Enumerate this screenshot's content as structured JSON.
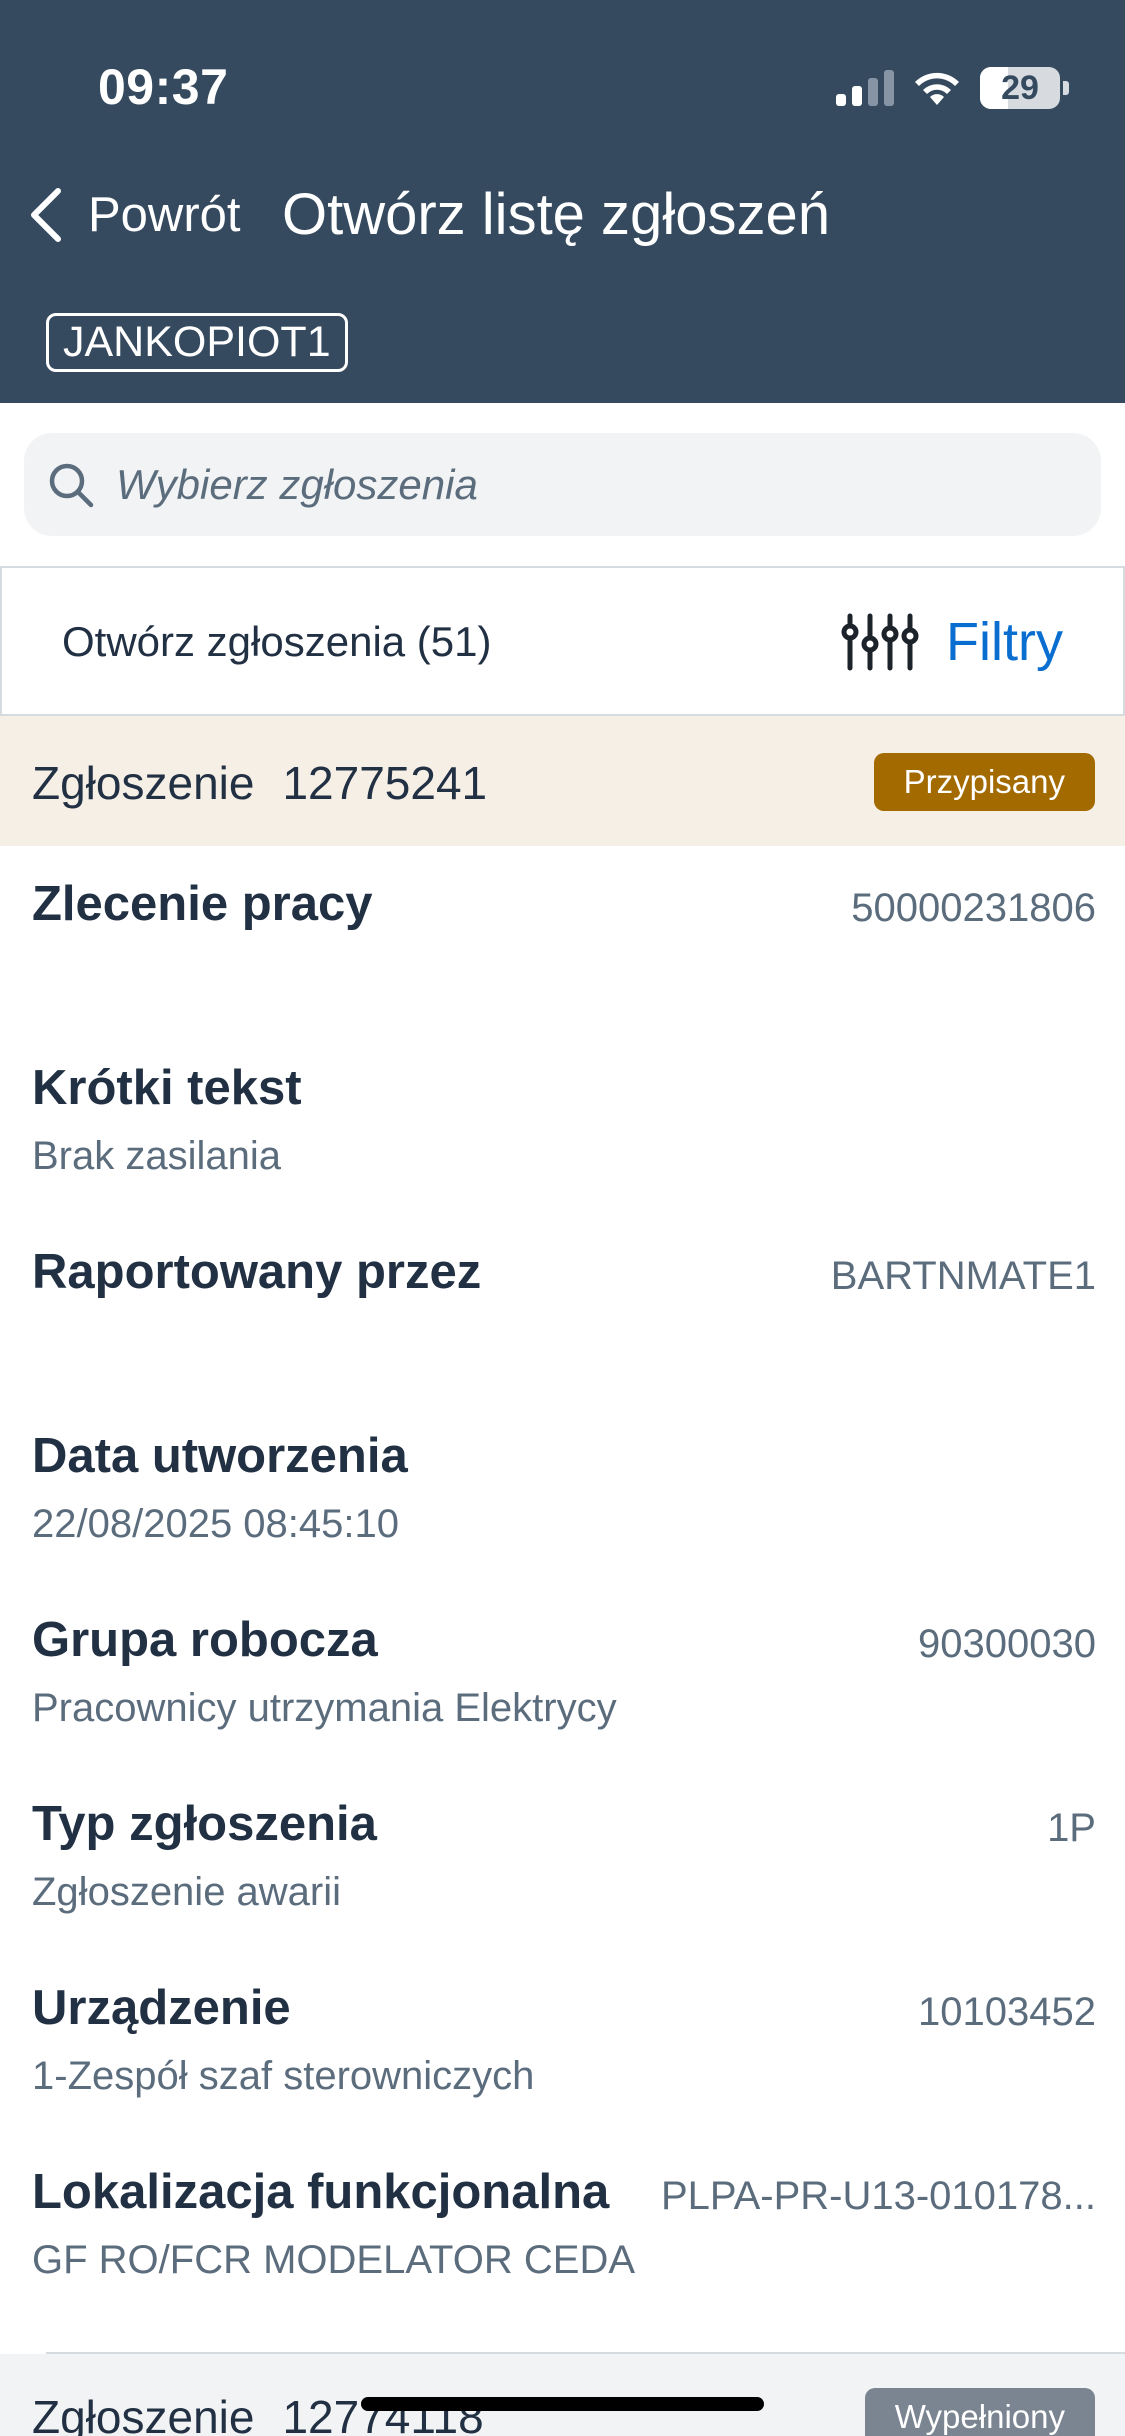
{
  "status_bar": {
    "time": "09:37",
    "battery": "29"
  },
  "nav": {
    "back_label": "Powrót",
    "title": "Otwórz listę zgłoszeń",
    "user": "JANKOPIOT1"
  },
  "search": {
    "placeholder": "Wybierz zgłoszenia"
  },
  "filter_bar": {
    "count_label": "Otwórz zgłoszenia (51)",
    "filter_label": "Filtry"
  },
  "colors": {
    "header_bg": "#354a5f",
    "accent": "#0a6ed1",
    "assigned_badge": "#a36a00",
    "filled_badge": "#7b8591",
    "notif_header_bg": "#f5efe6"
  },
  "notifications": [
    {
      "label": "Zgłoszenie",
      "number": "12775241",
      "status": "Przypisany",
      "fields": [
        {
          "label": "Zlecenie pracy",
          "value": "50000231806",
          "sub": ""
        },
        {
          "label": "Krótki tekst",
          "value": "",
          "sub": "Brak zasilania"
        },
        {
          "label": "Raportowany przez",
          "value": "BARTNMATE1",
          "sub": ""
        },
        {
          "label": "Data utworzenia",
          "value": "",
          "sub": "22/08/2025 08:45:10"
        },
        {
          "label": "Grupa robocza",
          "value": "90300030",
          "sub": "Pracownicy utrzymania Elektrycy"
        },
        {
          "label": "Typ zgłoszenia",
          "value": "1P",
          "sub": "Zgłoszenie awarii"
        },
        {
          "label": "Urządzenie",
          "value": "10103452",
          "sub": "1-Zespół szaf sterowniczych"
        },
        {
          "label": "Lokalizacja funkcjonalna",
          "value": "PLPA-PR-U13-010178...",
          "sub": "GF RO/FCR MODELATOR CEDA"
        }
      ]
    },
    {
      "label": "Zgłoszenie",
      "number": "12774118",
      "status": "Wypełniony"
    }
  ]
}
